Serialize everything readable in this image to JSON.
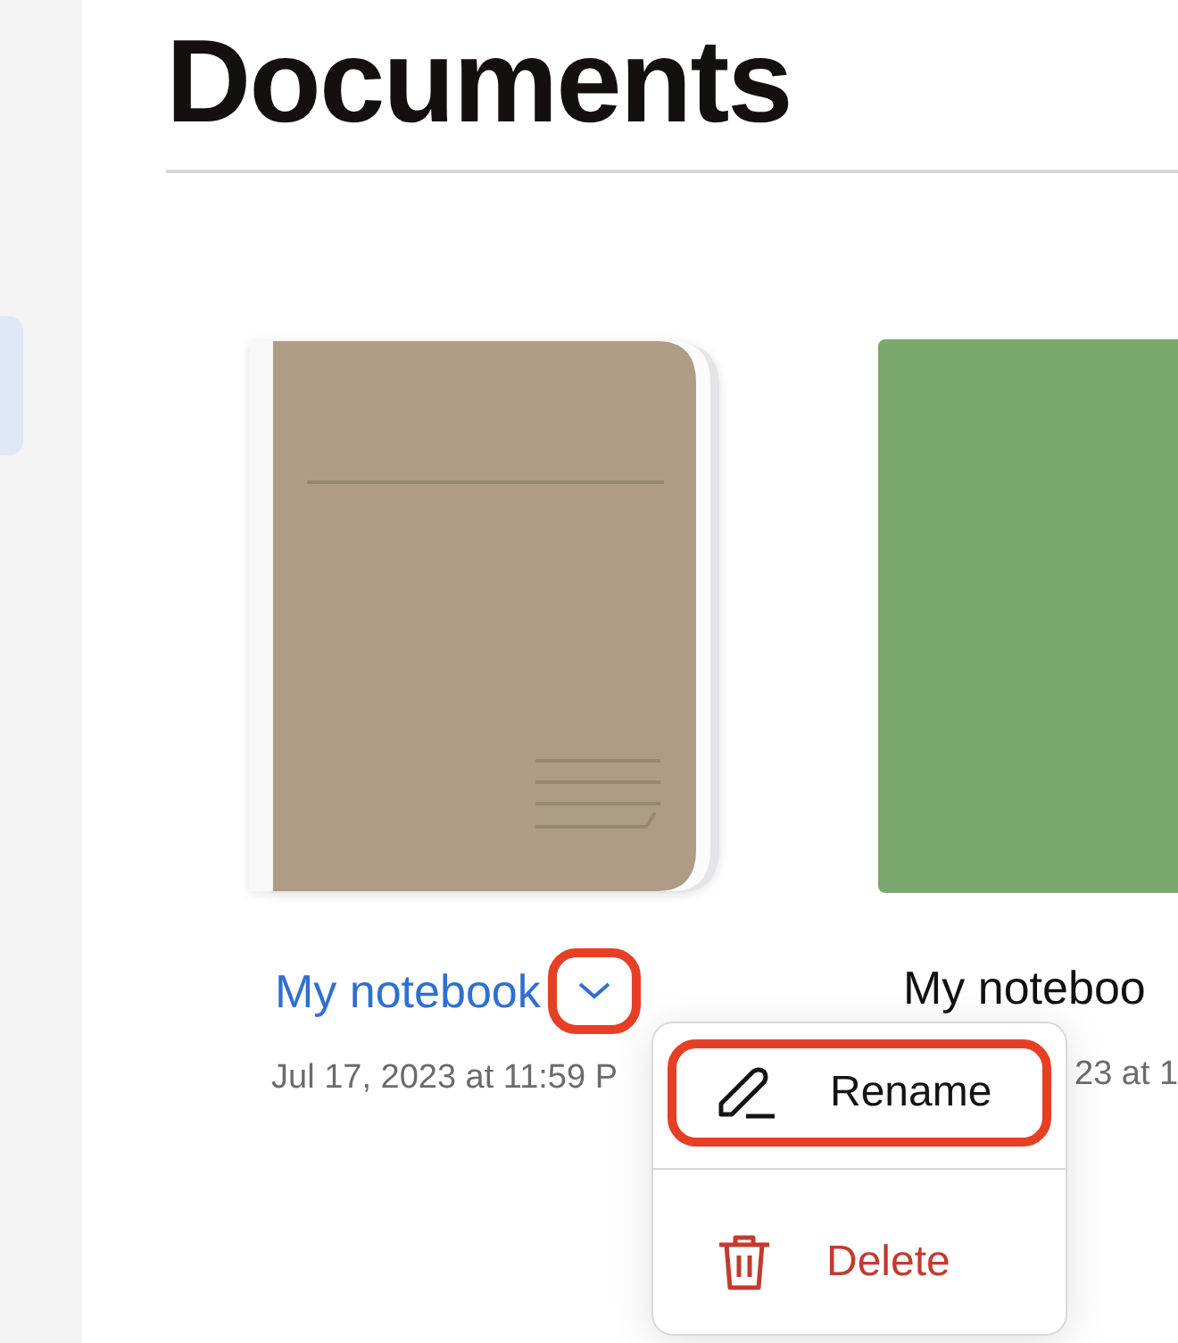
{
  "sidebar": {
    "items": [
      {
        "selected": true
      }
    ]
  },
  "page": {
    "title": "Documents"
  },
  "documents": [
    {
      "title": "My notebook",
      "date": "Jul 17, 2023 at 11:59 P",
      "color": "#ae9d84",
      "selected": true,
      "menu_open": true
    },
    {
      "title": "My noteboo",
      "date": "23 at 1",
      "color": "#7ba86c",
      "selected": false,
      "menu_open": false
    }
  ],
  "menu": {
    "items": [
      {
        "kind": "rename",
        "label": "Rename",
        "highlighted": true
      },
      {
        "kind": "delete",
        "label": "Delete",
        "highlighted": false
      }
    ]
  }
}
